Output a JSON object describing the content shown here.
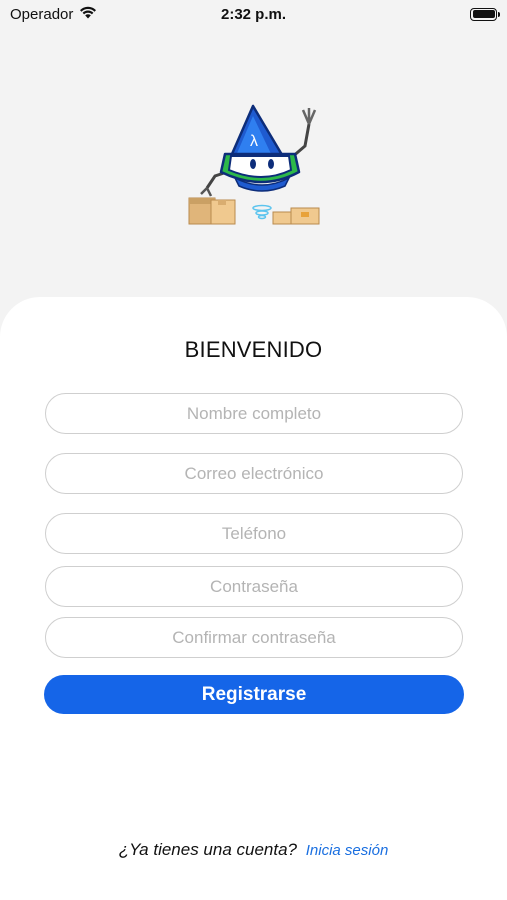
{
  "status_bar": {
    "carrier": "Operador",
    "time": "2:32 p.m."
  },
  "register": {
    "title": "BIENVENIDO",
    "fields": [
      {
        "placeholder": "Nombre completo",
        "value": ""
      },
      {
        "placeholder": "Correo electrónico",
        "value": ""
      },
      {
        "placeholder": "Teléfono",
        "value": ""
      },
      {
        "placeholder": "Contraseña",
        "value": ""
      },
      {
        "placeholder": "Confirmar contraseña",
        "value": ""
      }
    ],
    "submit_label": "Registrarse"
  },
  "footer": {
    "question": "¿Ya tienes una cuenta?",
    "link": "Inicia sesión"
  },
  "colors": {
    "accent": "#1565e8",
    "link": "#1a6fe0",
    "background": "#f3f3f3",
    "card": "#ffffff"
  },
  "icons": [
    "wifi-icon",
    "battery-icon",
    "robot-logo"
  ]
}
